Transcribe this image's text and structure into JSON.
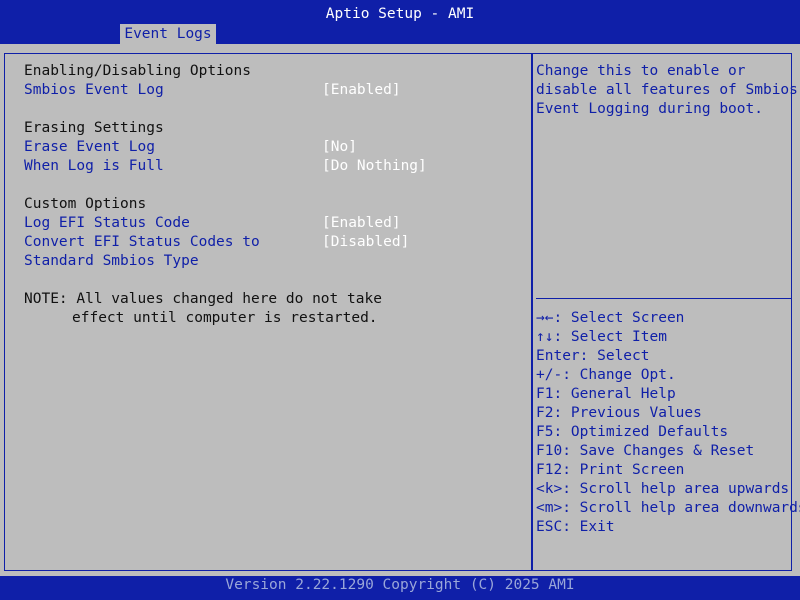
{
  "header": {
    "title": "Aptio Setup - AMI",
    "tab_label": "Event Logs"
  },
  "sections": [
    {
      "heading": "Enabling/Disabling Options",
      "items": [
        {
          "label": "Smbios Event Log",
          "value": "[Enabled]"
        }
      ]
    },
    {
      "heading": "Erasing Settings",
      "items": [
        {
          "label": "Erase Event Log",
          "value": "[No]"
        },
        {
          "label": "When Log is Full",
          "value": "[Do Nothing]"
        }
      ]
    },
    {
      "heading": "Custom Options",
      "items": [
        {
          "label": "Log EFI Status Code",
          "value": "[Enabled]"
        },
        {
          "label": "Convert EFI Status Codes to",
          "label_line2": "Standard Smbios Type",
          "value": "[Disabled]"
        }
      ]
    }
  ],
  "note": {
    "line1": "NOTE: All values changed here do not take",
    "line2": "effect until computer is restarted."
  },
  "help": {
    "lines": [
      "Change this to enable or",
      "disable all features of Smbios",
      "Event Logging during boot."
    ]
  },
  "keys": [
    "→←: Select Screen",
    "↑↓: Select Item",
    "Enter: Select",
    "+/-: Change Opt.",
    "F1: General Help",
    "F2: Previous Values",
    "F5: Optimized Defaults",
    "F10: Save Changes & Reset",
    "F12: Print Screen",
    "<k>: Scroll help area upwards",
    "<m>: Scroll help area downwards",
    "ESC: Exit"
  ],
  "footer": {
    "text": "Version 2.22.1290 Copyright (C) 2025 AMI"
  },
  "colors": {
    "bar_blue": "#0F1FA8",
    "panel_gray": "#BDBDBD",
    "value_white": "#FFFFFF",
    "footer_text": "#9AA6D8"
  }
}
